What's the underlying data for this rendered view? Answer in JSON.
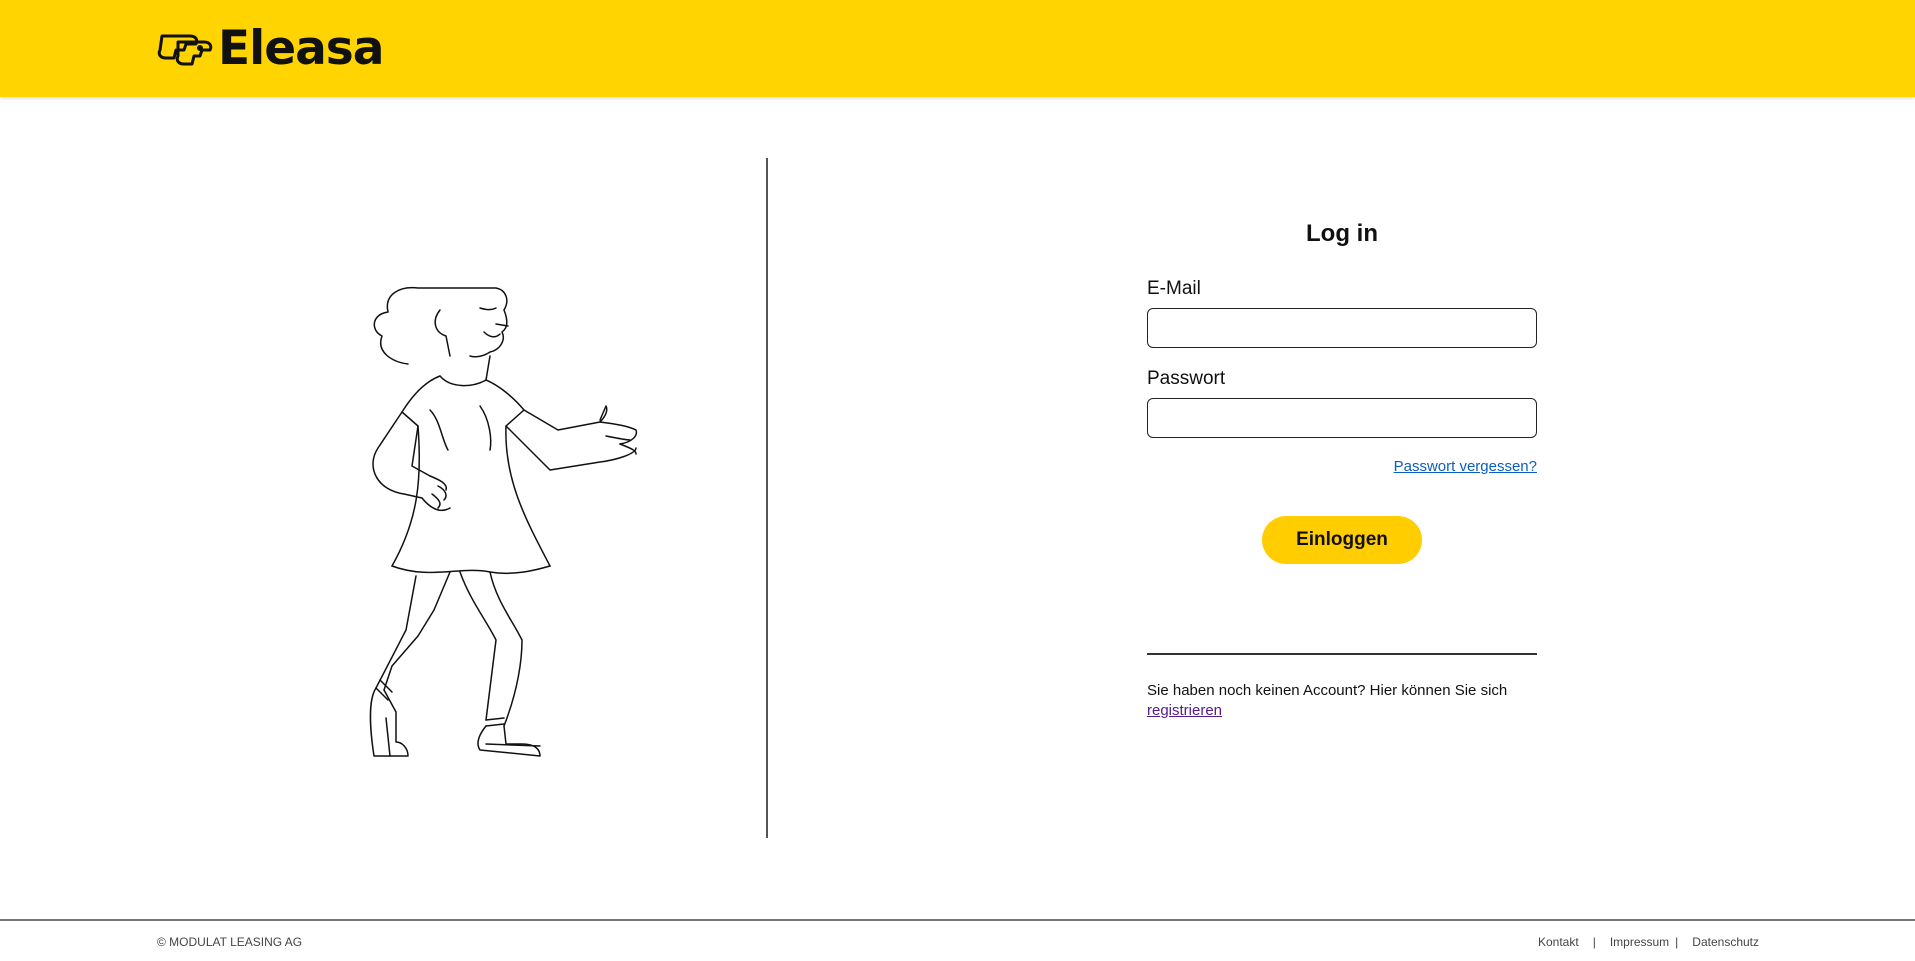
{
  "header": {
    "logo_text": "Eleasa",
    "logo_icon": "eleasa-faces-icon",
    "background_color": "#ffd400"
  },
  "illustration": {
    "icon": "walking-woman-illustration"
  },
  "login": {
    "title": "Log in",
    "email_label": "E-Mail",
    "email_value": "",
    "password_label": "Passwort",
    "password_value": "",
    "forgot_link": "Passwort vergessen?",
    "submit_label": "Einloggen",
    "button_color": "#ffcd00",
    "register_prompt": "Sie haben noch keinen Account? Hier können Sie sich",
    "register_link": "registrieren"
  },
  "footer": {
    "copyright": "© MODULAT LEASING AG",
    "links": [
      "Kontakt",
      "Impressum",
      "Datenschutz"
    ],
    "separator": "|"
  }
}
